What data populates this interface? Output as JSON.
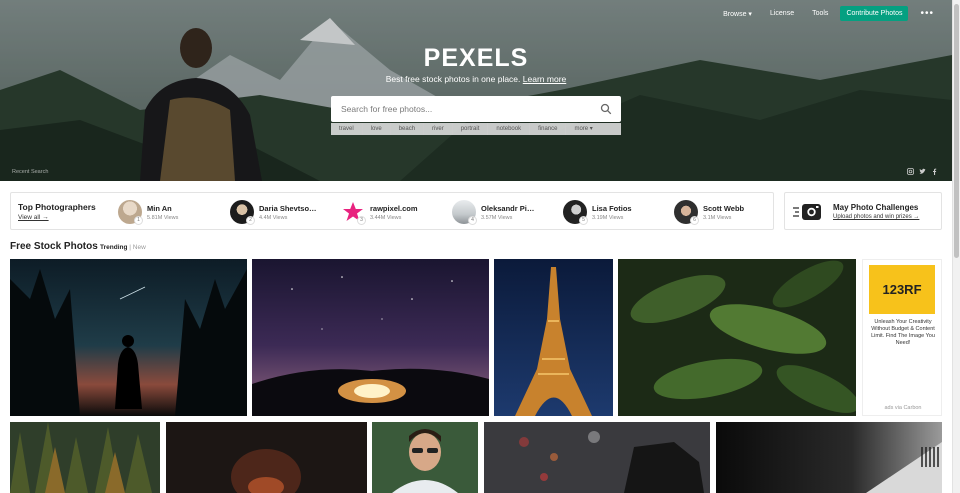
{
  "nav": {
    "browse": "Browse ▾",
    "license": "License",
    "tools": "Tools",
    "contribute": "Contribute Photos",
    "more": "•••"
  },
  "hero": {
    "brand": "PEXELS",
    "tagline": "Best free stock photos in one place.",
    "learn_more": "Learn more",
    "search_placeholder": "Search for free photos...",
    "tags": [
      "travel",
      "love",
      "beach",
      "river",
      "portrait",
      "notebook",
      "finance",
      "more ▾"
    ],
    "credit": "Recent Search"
  },
  "top_photographers": {
    "title": "Top Photographers",
    "view_all": "View all →",
    "people": [
      {
        "name": "Min An",
        "views": "5.81M Views",
        "rank": "1"
      },
      {
        "name": "Daria Shevtso…",
        "views": "4.4M Views",
        "rank": "2"
      },
      {
        "name": "rawpixel.com",
        "views": "3.44M Views",
        "rank": "3"
      },
      {
        "name": "Oleksandr Pi…",
        "views": "3.57M Views",
        "rank": "4"
      },
      {
        "name": "Lisa Fotios",
        "views": "3.19M Views",
        "rank": "5"
      },
      {
        "name": "Scott Webb",
        "views": "3.1M Views",
        "rank": "6"
      }
    ]
  },
  "challenge": {
    "title": "May Photo Challenges",
    "subtitle": "Upload photos and win prizes →"
  },
  "section": {
    "title": "Free Stock Photos",
    "tab_trending": "Trending",
    "separator": " | ",
    "tab_new": "New"
  },
  "ad": {
    "logo": "123RF",
    "text": "Unleash Your Creativity Without Budget & Content Limit. Find The Image You Need!",
    "via": "ads via Carbon"
  },
  "colors": {
    "accent": "#05a081",
    "ad_yellow": "#f7c21b"
  }
}
